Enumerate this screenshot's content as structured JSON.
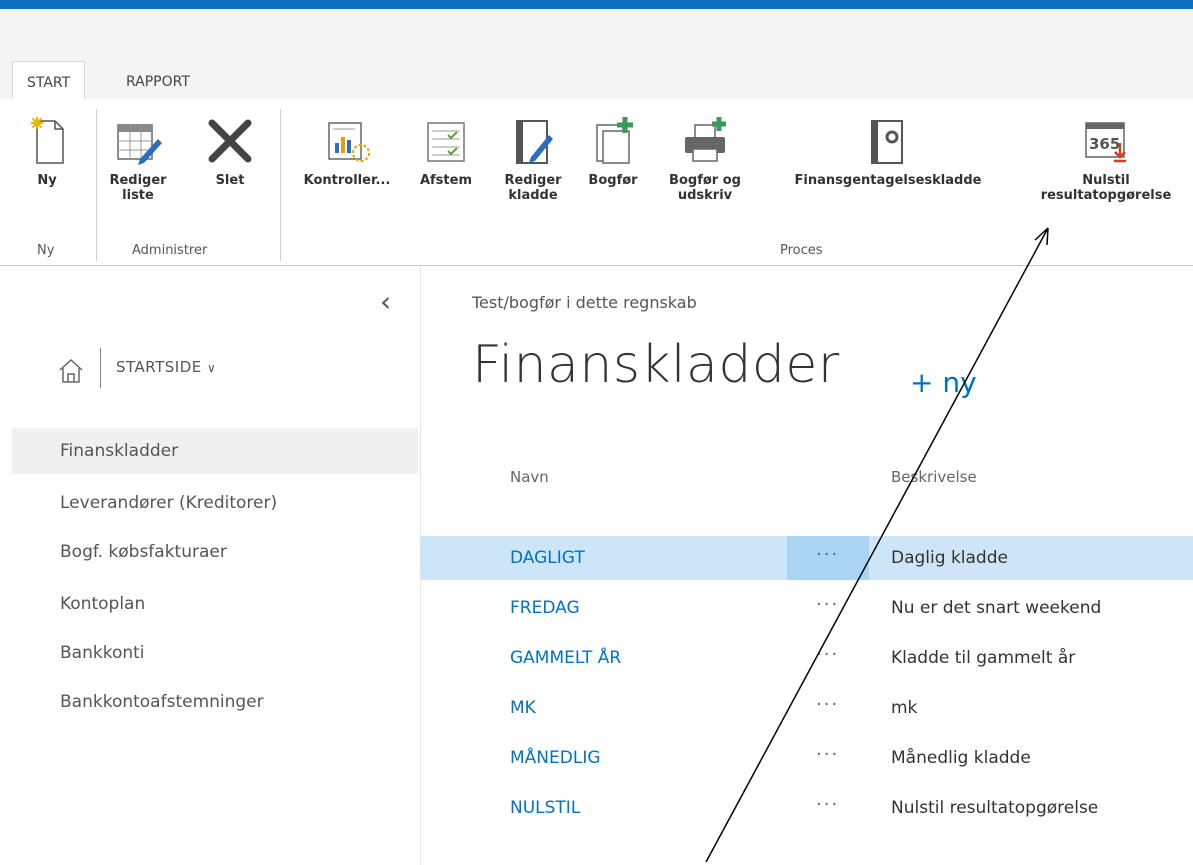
{
  "tabs": {
    "start": "START",
    "rapport": "RAPPORT"
  },
  "ribbon": {
    "ny": {
      "label": "Ny",
      "group": "Ny"
    },
    "administrer": {
      "rediger_liste": [
        "Rediger",
        "liste"
      ],
      "slet": "Slet",
      "group": "Administrer"
    },
    "proces": {
      "kontroller": "Kontroller...",
      "afstem": "Afstem",
      "rediger_kladde": [
        "Rediger",
        "kladde"
      ],
      "bogfor": "Bogfør",
      "bogfor_udskriv": [
        "Bogfør og",
        "udskriv"
      ],
      "finansgentagelseskladde": "Finansgentagelseskladde",
      "nulstil": [
        "Nulstil",
        "resultatopgørelse"
      ],
      "group": "Proces",
      "calendar_number": "365"
    }
  },
  "nav": {
    "home_label": "STARTSIDE",
    "items": [
      "Finanskladder",
      "Leverandører (Kreditorer)",
      "Bogf. købsfakturaer",
      "Kontoplan",
      "Bankkonti",
      "Bankkontoafstemninger"
    ]
  },
  "main": {
    "breadcrumb": "Test/bogfør i dette regnskab",
    "title": "Finanskladder",
    "new_link": "+ ny",
    "columns": {
      "name": "Navn",
      "description": "Beskrivelse"
    },
    "dots": "···",
    "rows": [
      {
        "name": "DAGLIGT",
        "description": "Daglig kladde"
      },
      {
        "name": "FREDAG",
        "description": "Nu er det snart weekend"
      },
      {
        "name": "GAMMELT ÅR",
        "description": "Kladde til gammelt år"
      },
      {
        "name": "MK",
        "description": "mk"
      },
      {
        "name": "MÅNEDLIG",
        "description": "Månedlig kladde"
      },
      {
        "name": "NULSTIL",
        "description": "Nulstil resultatopgørelse"
      }
    ]
  },
  "colors": {
    "accent": "#0072c6",
    "topbar": "#106ebe",
    "selected_row": "#cde6f7"
  }
}
